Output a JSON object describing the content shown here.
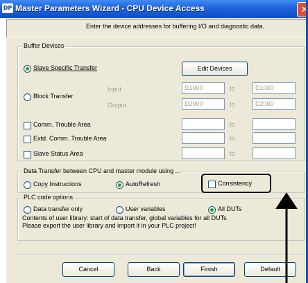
{
  "window": {
    "app_icon": "DP",
    "title": "Master Parameters Wizard - CPU Device Access",
    "close_glyph": "✕"
  },
  "intro": "Enter the device addresses for buffering I/O and diagnostic data.",
  "buffer_devices": {
    "legend": "Buffer Devices",
    "slave_specific_label": "Slave Specific Transfer",
    "slave_specific_selected": true,
    "edit_devices_label": "Edit Devices",
    "block_transfer_label": "Block Transfer",
    "block_transfer_selected": false,
    "input_label": "Input",
    "output_label": "Output",
    "input_from": "D1000",
    "input_to": "D1000",
    "output_from": "D2000",
    "output_to": "D2000",
    "to_label": "to",
    "comm_trouble_label": "Comm. Trouble Area",
    "extd_comm_trouble_label": "Extd. Comm. Trouble Area",
    "slave_status_label": "Slave Status Area"
  },
  "data_transfer": {
    "legend": "Data Transfer between CPU and master module using ...",
    "copy_label": "Copy Instructions",
    "copy_selected": false,
    "autorefresh_label": "AutoRefresh",
    "autorefresh_selected": true,
    "consistency_label": "Consistency",
    "consistency_checked": false
  },
  "plc_code": {
    "legend": "PLC code options",
    "data_only_label": "Data transfer only",
    "user_vars_label": "User variables",
    "all_duts_label": "All DUTs",
    "all_duts_selected": true,
    "note_line1": "Contents of user library: start of data transfer, global variables for all DUTs",
    "note_line2": "Please export the user library and import it in your PLC project!"
  },
  "buttons": {
    "cancel": "Cancel",
    "back": "Back",
    "finish": "Finish",
    "default": "Default"
  },
  "colors": {
    "titlebar": "#1f63dc",
    "client": "#ece9d8",
    "selected_radio": "#21a121"
  }
}
